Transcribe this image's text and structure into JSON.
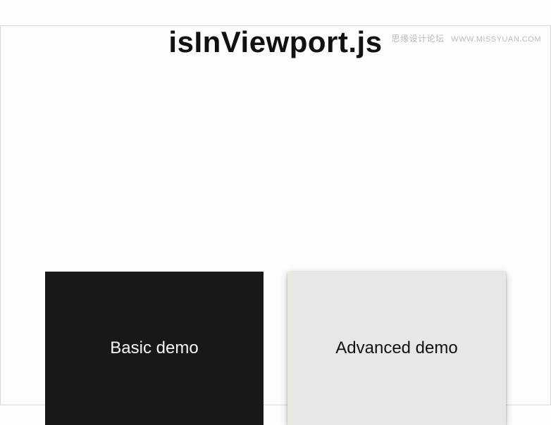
{
  "watermark": {
    "cn": "思缘设计论坛",
    "url": "WWW.MISSYUAN.COM"
  },
  "header": {
    "title": "isInViewport.js"
  },
  "cards": {
    "basic": {
      "label": "Basic demo"
    },
    "advanced": {
      "label": "Advanced demo"
    }
  }
}
